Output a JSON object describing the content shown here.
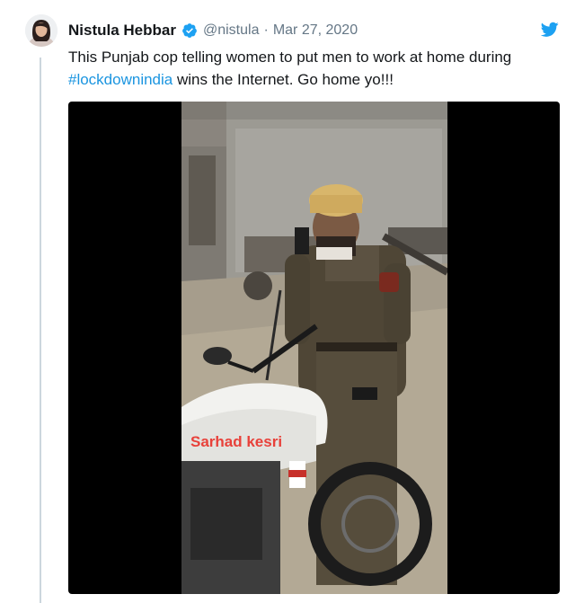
{
  "tweet": {
    "author_name": "Nistula Hebbar",
    "handle": "@nistula",
    "separator": "·",
    "date": "Mar 27, 2020",
    "text_before": "This Punjab cop telling women to put men to work at home during ",
    "hashtag": "#lockdownindia",
    "text_after": " wins the Internet. Go home yo!!!"
  },
  "media": {
    "watermark": "Sarhad kesri"
  },
  "colors": {
    "link": "#1b95e0",
    "verified": "#1da1f2",
    "twitter_bird": "#1da1f2",
    "muted_text": "#657786"
  },
  "icons": [
    "verified-badge-icon",
    "twitter-bird-icon"
  ]
}
